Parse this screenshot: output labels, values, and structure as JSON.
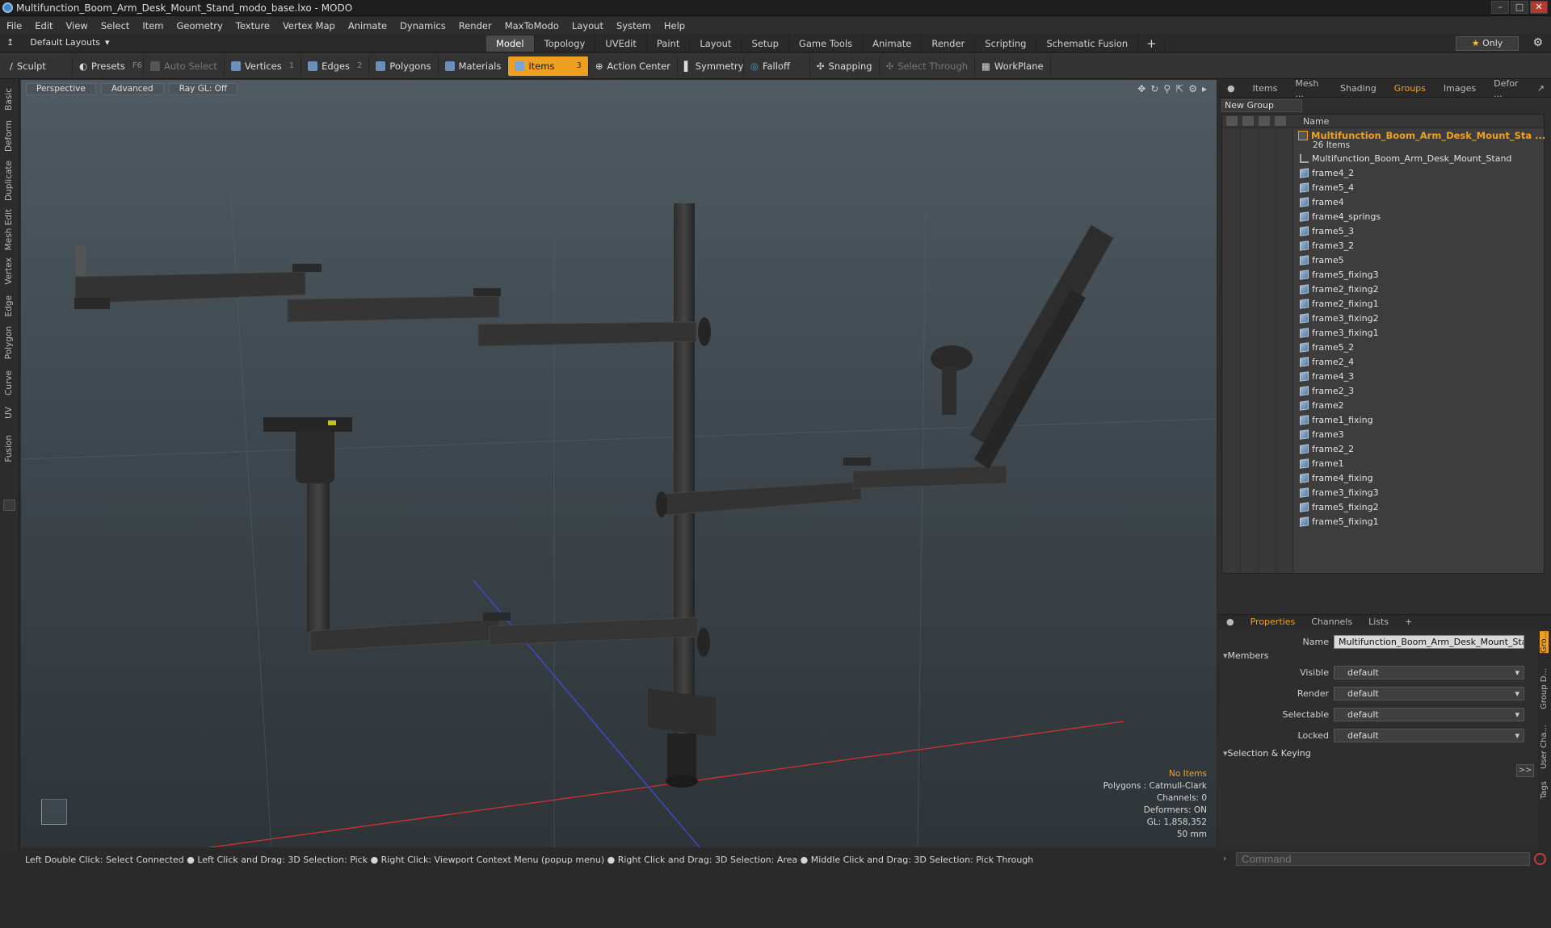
{
  "window": {
    "title": "Multifunction_Boom_Arm_Desk_Mount_Stand_modo_base.lxo - MODO"
  },
  "menu": [
    "File",
    "Edit",
    "View",
    "Select",
    "Item",
    "Geometry",
    "Texture",
    "Vertex Map",
    "Animate",
    "Dynamics",
    "Render",
    "MaxToModo",
    "Layout",
    "System",
    "Help"
  ],
  "layout": {
    "default_layouts": "Default Layouts",
    "tabs": [
      "Model",
      "Topology",
      "UVEdit",
      "Paint",
      "Layout",
      "Setup",
      "Game Tools",
      "Animate",
      "Render",
      "Scripting",
      "Schematic Fusion"
    ],
    "active_tab": "Model",
    "plus": "+",
    "only": "Only"
  },
  "toolbar": {
    "sculpt": "Sculpt",
    "presets": "Presets",
    "presets_key": "F6",
    "auto_select": "Auto Select",
    "vertices": "Vertices",
    "vertices_count": "1",
    "edges": "Edges",
    "edges_count": "2",
    "polygons": "Polygons",
    "materials": "Materials",
    "items": "Items",
    "items_count": "3",
    "action_center": "Action Center",
    "symmetry": "Symmetry",
    "falloff": "Falloff",
    "snapping": "Snapping",
    "select_through": "Select Through",
    "workplane": "WorkPlane"
  },
  "left_tabs": [
    "Basic",
    "Deform",
    "Duplicate",
    "Mesh Edit",
    "Vertex",
    "Edge",
    "Polygon",
    "Curve",
    "UV",
    "Fusion"
  ],
  "viewport": {
    "perspective": "Perspective",
    "advanced": "Advanced",
    "raygl": "Ray GL: Off",
    "info": {
      "no_items": "No Items",
      "polygons": "Polygons : Catmull-Clark",
      "channels": "Channels: 0",
      "deformers": "Deformers: ON",
      "gl": "GL: 1,858,352",
      "mm": "50 mm"
    }
  },
  "panel": {
    "tabs": [
      "Items",
      "Mesh ...",
      "Shading",
      "Groups",
      "Images",
      "Defor ..."
    ],
    "active_tab": "Groups",
    "new_group": "New Group",
    "name_header": "Name",
    "group_name": "Multifunction_Boom_Arm_Desk_Mount_Sta ...",
    "group_count": "26 Items",
    "items": [
      "Multifunction_Boom_Arm_Desk_Mount_Stand",
      "frame4_2",
      "frame5_4",
      "frame4",
      "frame4_springs",
      "frame5_3",
      "frame3_2",
      "frame5",
      "frame5_fixing3",
      "frame2_fixing2",
      "frame2_fixing1",
      "frame3_fixing2",
      "frame3_fixing1",
      "frame5_2",
      "frame2_4",
      "frame4_3",
      "frame2_3",
      "frame2",
      "frame1_fixing",
      "frame3",
      "frame2_2",
      "frame1",
      "frame4_fixing",
      "frame3_fixing3",
      "frame5_fixing2",
      "frame5_fixing1"
    ]
  },
  "properties": {
    "tabs": [
      "Properties",
      "Channels",
      "Lists"
    ],
    "active_tab": "Properties",
    "name_label": "Name",
    "name_value": "Multifunction_Boom_Arm_Desk_Mount_Stand (",
    "members": "Members",
    "visible_label": "Visible",
    "visible_value": "default",
    "render_label": "Render",
    "render_value": "default",
    "selectable_label": "Selectable",
    "selectable_value": "default",
    "locked_label": "Locked",
    "locked_value": "default",
    "sel_keying": "Selection & Keying",
    "more": ">>",
    "side_tabs": [
      "Gro...",
      "Group D...",
      "User Cha...",
      "Tags"
    ]
  },
  "status": "Left Double Click: Select Connected ● Left Click and Drag: 3D Selection: Pick ● Right Click: Viewport Context Menu (popup menu) ● Right Click and Drag: 3D Selection: Area ● Middle Click and Drag: 3D Selection: Pick Through",
  "command_placeholder": "Command",
  "colors": {
    "accent": "#f0a020"
  }
}
